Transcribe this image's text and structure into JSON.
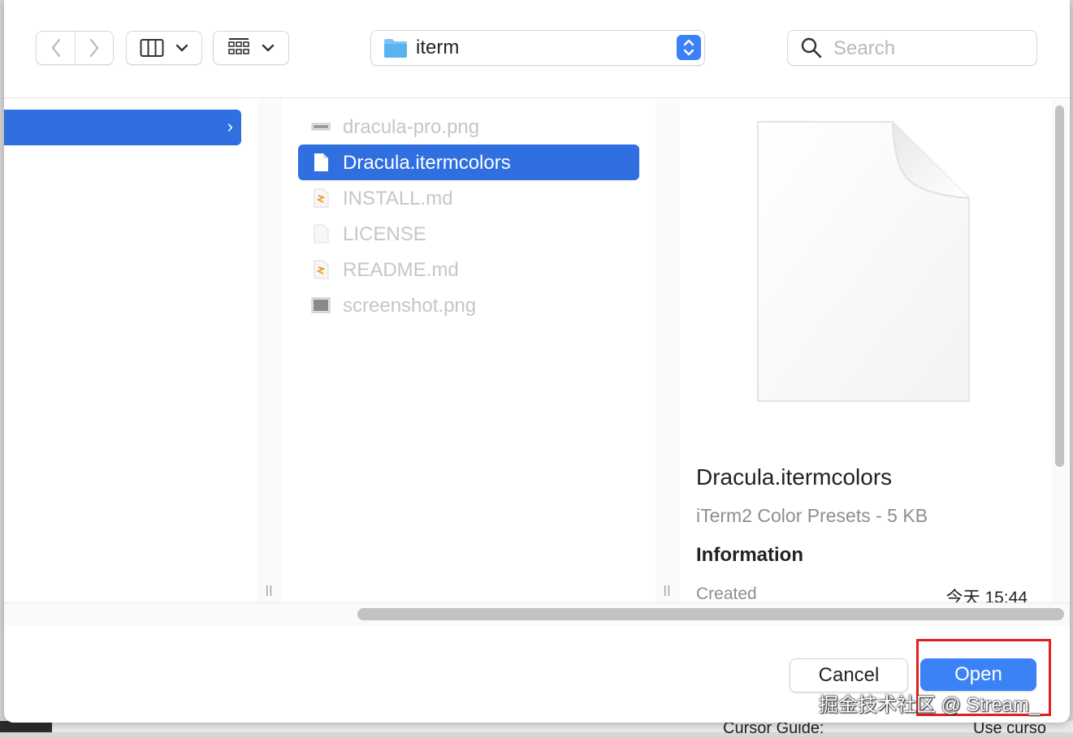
{
  "toolbar": {
    "location": "iterm",
    "search_placeholder": "Search"
  },
  "files": [
    {
      "name": "dracula-pro.png",
      "icon": "image-file-icon",
      "selected": false
    },
    {
      "name": "Dracula.itermcolors",
      "icon": "document-icon",
      "selected": true
    },
    {
      "name": "INSTALL.md",
      "icon": "markdown-file-icon",
      "selected": false
    },
    {
      "name": "LICENSE",
      "icon": "blank-document-icon",
      "selected": false
    },
    {
      "name": "README.md",
      "icon": "markdown-file-icon",
      "selected": false
    },
    {
      "name": "screenshot.png",
      "icon": "image-file-icon",
      "selected": false
    }
  ],
  "preview": {
    "name": "Dracula.itermcolors",
    "kind_size": "iTerm2 Color Presets - 5 KB",
    "info_heading": "Information",
    "created_label": "Created",
    "created_value": "今天 15:44"
  },
  "footer": {
    "cancel": "Cancel",
    "open": "Open"
  },
  "watermark": "掘金技术社区 @ Stream_",
  "background": {
    "left_text": "Cursor Guide:",
    "right_text": "Use curso"
  },
  "colors": {
    "accent": "#3b82f6",
    "selection": "#2f6fe0",
    "highlight_box": "#e02020"
  }
}
